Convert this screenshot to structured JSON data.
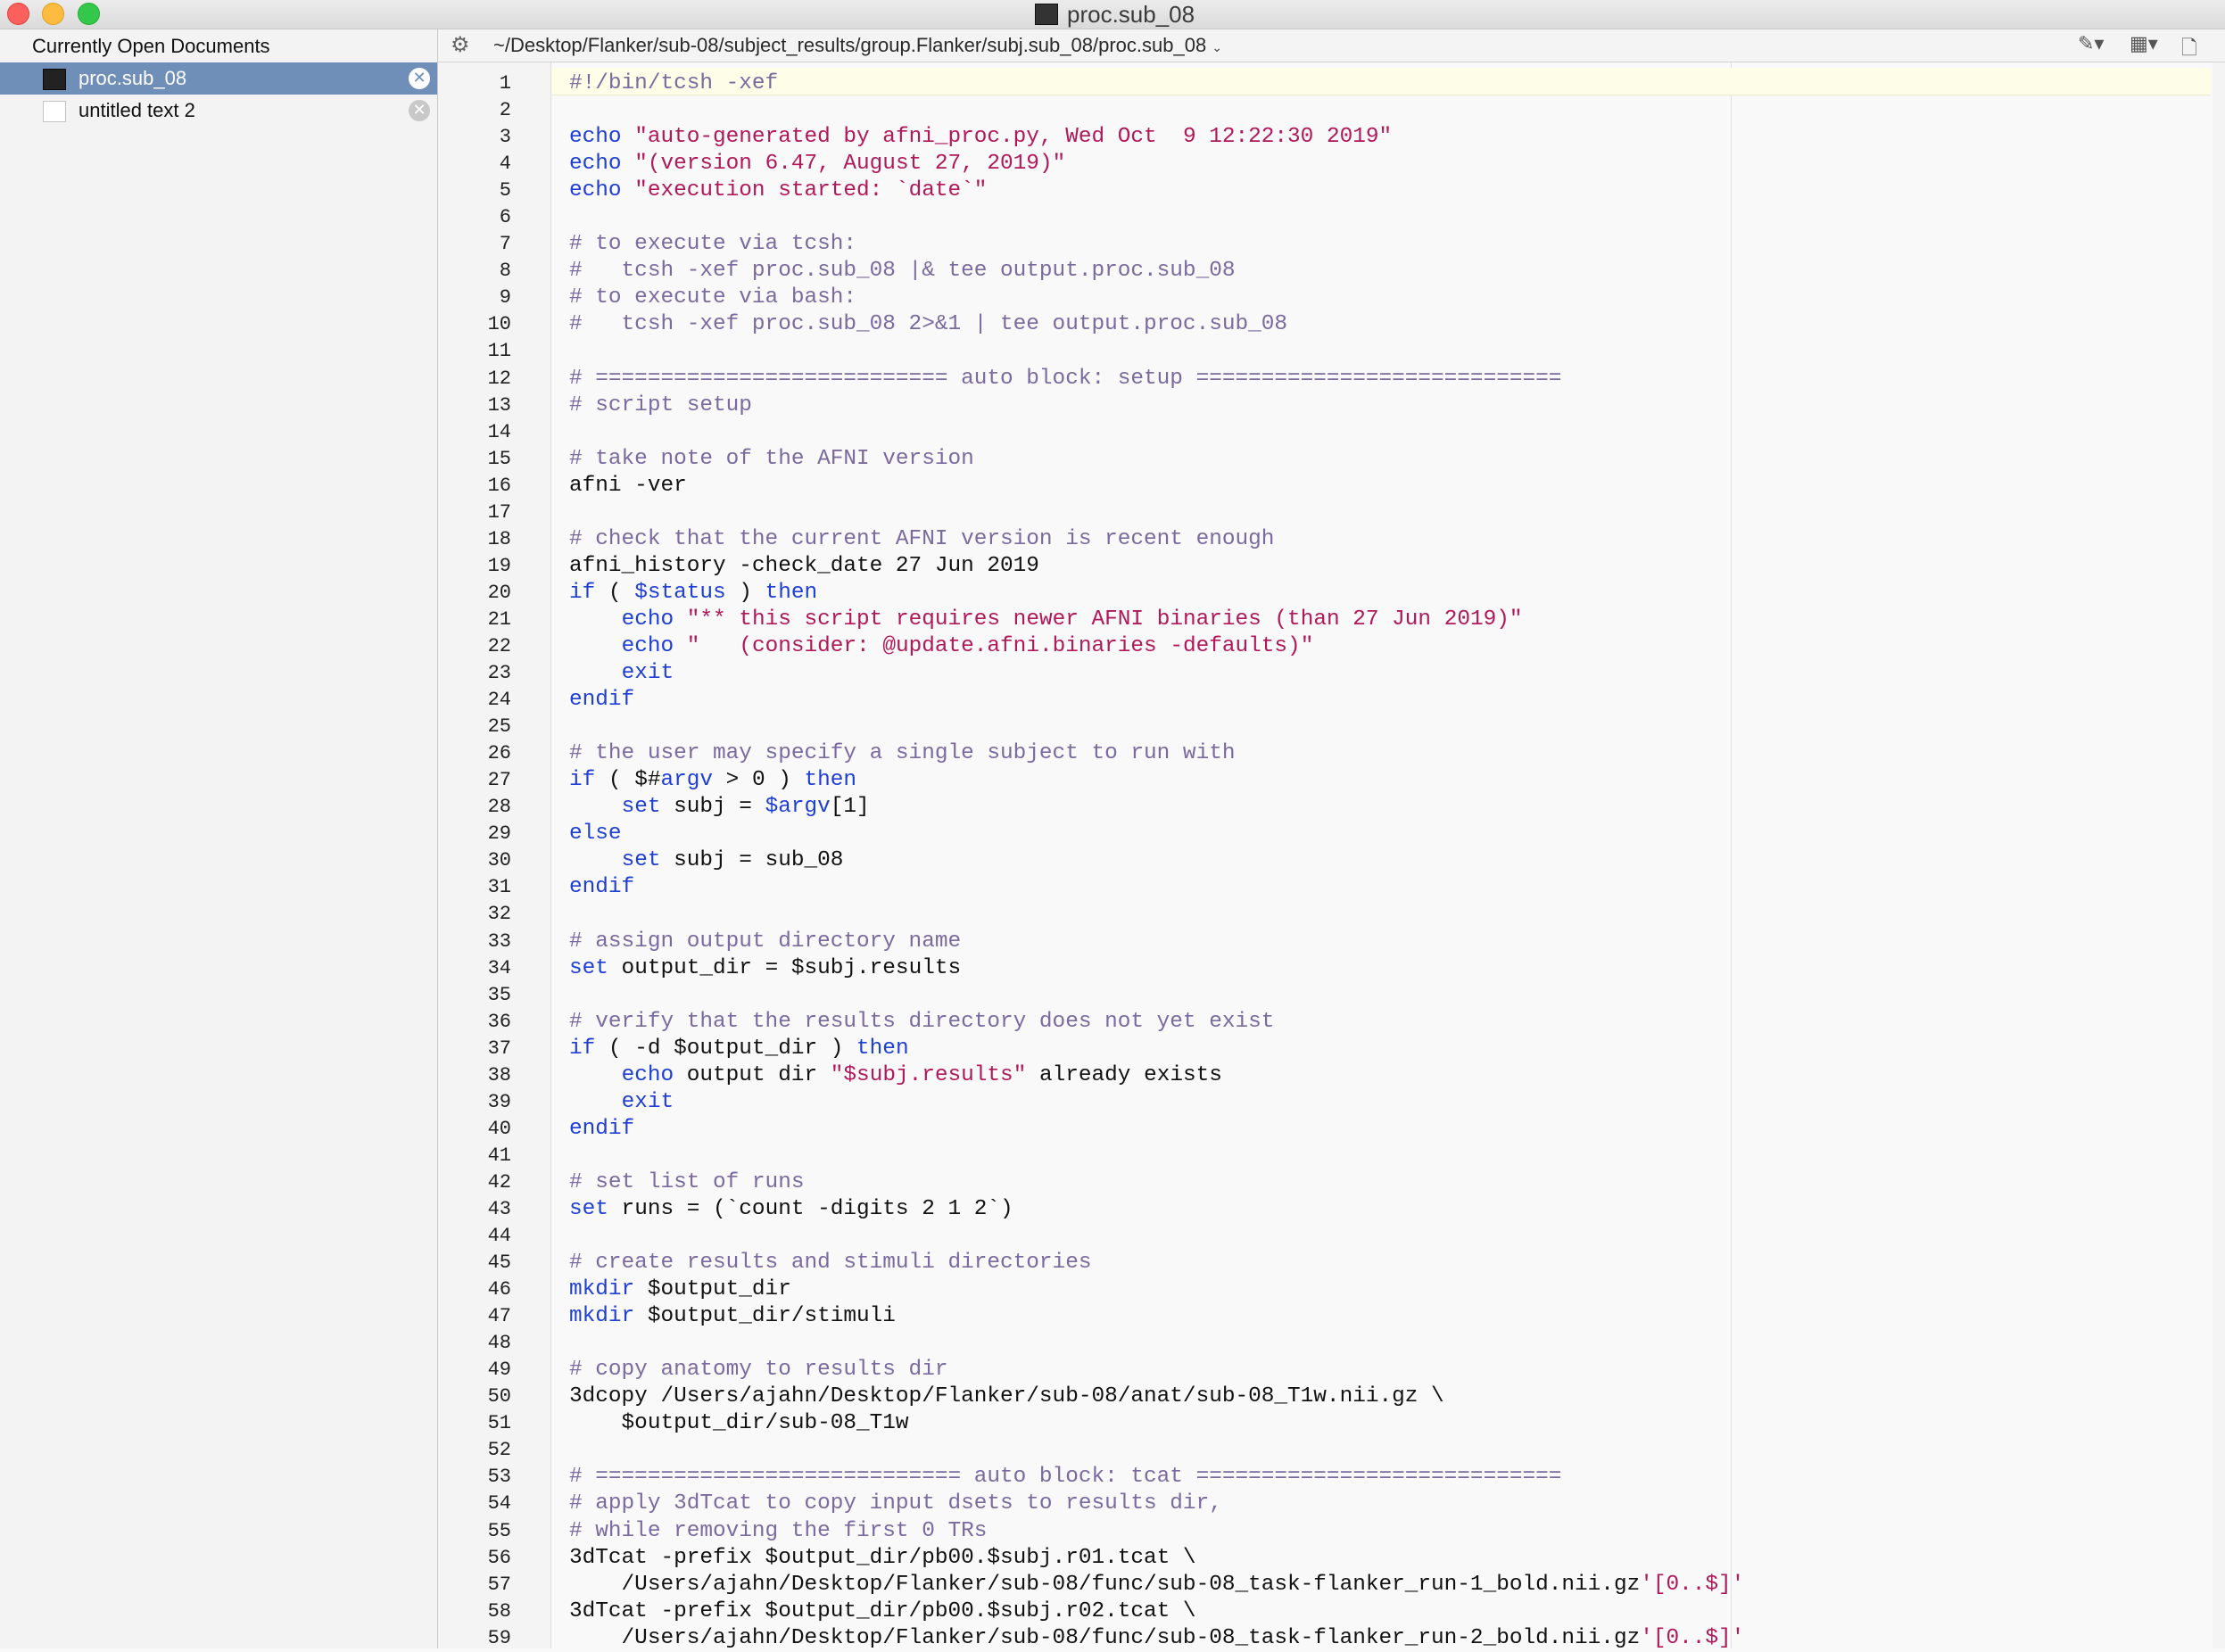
{
  "window": {
    "title": "proc.sub_08"
  },
  "sidebar": {
    "header": "Currently Open Documents",
    "documents": [
      {
        "name": "proc.sub_08",
        "selected": true,
        "icon": "terminal-document-icon"
      },
      {
        "name": "untitled text 2",
        "selected": false,
        "icon": "text-document-icon"
      }
    ]
  },
  "pathbar": {
    "path": "~/Desktop/Flanker/sub-08/subject_results/group.Flanker/subj.sub_08/proc.sub_08"
  },
  "editor": {
    "lines": [
      [
        [
          "c",
          "#!/bin/tcsh -xef"
        ]
      ],
      [],
      [
        [
          "k",
          "echo"
        ],
        [
          "t",
          " "
        ],
        [
          "s",
          "\"auto-generated by afni_proc.py, Wed Oct  9 12:22:30 2019\""
        ]
      ],
      [
        [
          "k",
          "echo"
        ],
        [
          "t",
          " "
        ],
        [
          "s",
          "\"(version 6.47, August 27, 2019)\""
        ]
      ],
      [
        [
          "k",
          "echo"
        ],
        [
          "t",
          " "
        ],
        [
          "s",
          "\"execution started: `date`\""
        ]
      ],
      [],
      [
        [
          "c",
          "# to execute via tcsh:"
        ]
      ],
      [
        [
          "c",
          "#   tcsh -xef proc.sub_08 |& tee output.proc.sub_08"
        ]
      ],
      [
        [
          "c",
          "# to execute via bash:"
        ]
      ],
      [
        [
          "c",
          "#   tcsh -xef proc.sub_08 2>&1 | tee output.proc.sub_08"
        ]
      ],
      [],
      [
        [
          "c",
          "# =========================== auto block: setup ============================"
        ]
      ],
      [
        [
          "c",
          "# script setup"
        ]
      ],
      [],
      [
        [
          "c",
          "# take note of the AFNI version"
        ]
      ],
      [
        [
          "t",
          "afni -ver"
        ]
      ],
      [],
      [
        [
          "c",
          "# check that the current AFNI version is recent enough"
        ]
      ],
      [
        [
          "t",
          "afni_history -check_date 27 Jun 2019"
        ]
      ],
      [
        [
          "k",
          "if"
        ],
        [
          "t",
          " ( "
        ],
        [
          "v",
          "$status"
        ],
        [
          "t",
          " ) "
        ],
        [
          "k",
          "then"
        ]
      ],
      [
        [
          "t",
          "    "
        ],
        [
          "k",
          "echo"
        ],
        [
          "t",
          " "
        ],
        [
          "s",
          "\"** this script requires newer AFNI binaries (than 27 Jun 2019)\""
        ]
      ],
      [
        [
          "t",
          "    "
        ],
        [
          "k",
          "echo"
        ],
        [
          "t",
          " "
        ],
        [
          "s",
          "\"   (consider: @update.afni.binaries -defaults)\""
        ]
      ],
      [
        [
          "t",
          "    "
        ],
        [
          "k",
          "exit"
        ]
      ],
      [
        [
          "k",
          "endif"
        ]
      ],
      [],
      [
        [
          "c",
          "# the user may specify a single subject to run with"
        ]
      ],
      [
        [
          "k",
          "if"
        ],
        [
          "t",
          " ( $#"
        ],
        [
          "v",
          "argv"
        ],
        [
          "t",
          " > 0 ) "
        ],
        [
          "k",
          "then"
        ]
      ],
      [
        [
          "t",
          "    "
        ],
        [
          "k",
          "set"
        ],
        [
          "t",
          " subj = "
        ],
        [
          "v",
          "$argv"
        ],
        [
          "t",
          "[1]"
        ]
      ],
      [
        [
          "k",
          "else"
        ]
      ],
      [
        [
          "t",
          "    "
        ],
        [
          "k",
          "set"
        ],
        [
          "t",
          " subj = sub_08"
        ]
      ],
      [
        [
          "k",
          "endif"
        ]
      ],
      [],
      [
        [
          "c",
          "# assign output directory name"
        ]
      ],
      [
        [
          "k",
          "set"
        ],
        [
          "t",
          " output_dir = $subj.results"
        ]
      ],
      [],
      [
        [
          "c",
          "# verify that the results directory does not yet exist"
        ]
      ],
      [
        [
          "k",
          "if"
        ],
        [
          "t",
          " ( -d $output_dir ) "
        ],
        [
          "k",
          "then"
        ]
      ],
      [
        [
          "t",
          "    "
        ],
        [
          "k",
          "echo"
        ],
        [
          "t",
          " output dir "
        ],
        [
          "s",
          "\"$subj.results\""
        ],
        [
          "t",
          " already exists"
        ]
      ],
      [
        [
          "t",
          "    "
        ],
        [
          "k",
          "exit"
        ]
      ],
      [
        [
          "k",
          "endif"
        ]
      ],
      [],
      [
        [
          "c",
          "# set list of runs"
        ]
      ],
      [
        [
          "k",
          "set"
        ],
        [
          "t",
          " runs = (`count -digits 2 1 2`)"
        ]
      ],
      [],
      [
        [
          "c",
          "# create results and stimuli directories"
        ]
      ],
      [
        [
          "k",
          "mkdir"
        ],
        [
          "t",
          " $output_dir"
        ]
      ],
      [
        [
          "k",
          "mkdir"
        ],
        [
          "t",
          " $output_dir/stimuli"
        ]
      ],
      [],
      [
        [
          "c",
          "# copy anatomy to results dir"
        ]
      ],
      [
        [
          "t",
          "3dcopy /Users/ajahn/Desktop/Flanker/sub-08/anat/sub-08_T1w.nii.gz \\"
        ]
      ],
      [
        [
          "t",
          "    $output_dir/sub-08_T1w"
        ]
      ],
      [],
      [
        [
          "c",
          "# ============================ auto block: tcat ============================"
        ]
      ],
      [
        [
          "c",
          "# apply 3dTcat to copy input dsets to results dir,"
        ]
      ],
      [
        [
          "c",
          "# while removing the first 0 TRs"
        ]
      ],
      [
        [
          "t",
          "3dTcat -prefix $output_dir/pb00.$subj.r01.tcat \\"
        ]
      ],
      [
        [
          "t",
          "    /Users/ajahn/Desktop/Flanker/sub-08/func/sub-08_task-flanker_run-1_bold.nii.gz"
        ],
        [
          "s",
          "'[0..$]'"
        ]
      ],
      [
        [
          "t",
          "3dTcat -prefix $output_dir/pb00.$subj.r02.tcat \\"
        ]
      ],
      [
        [
          "t",
          "    /Users/ajahn/Desktop/Flanker/sub-08/func/sub-08_task-flanker_run-2_bold.nii.gz"
        ],
        [
          "s",
          "'[0..$]'"
        ]
      ]
    ]
  },
  "colors": {
    "selection": "#6f8fb8",
    "comment": "#7a6aa0",
    "keyword": "#1e3ed4",
    "string": "#b0185a"
  }
}
